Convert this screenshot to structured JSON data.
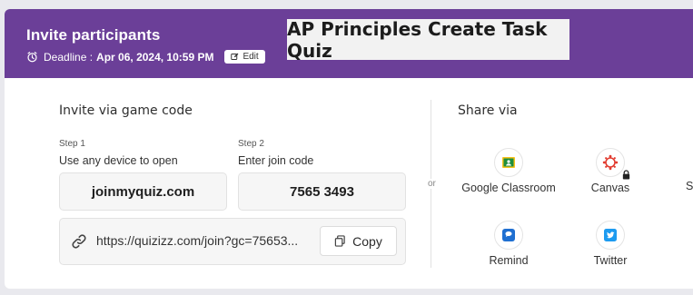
{
  "header": {
    "title": "Invite participants",
    "deadline_label": "Deadline :",
    "deadline_value": "Apr 06, 2024, 10:59 PM",
    "edit_label": "Edit",
    "quiz_title": "AP Principles Create Task Quiz",
    "bg_color": "#6b3f98",
    "clock_icon": "alarm-clock-icon",
    "edit_icon": "pencil-square-icon"
  },
  "invite": {
    "section_title": "Invite via game code",
    "step1_label": "Step 1",
    "step1_text": "Use any device to open",
    "site": "joinmyquiz.com",
    "step2_label": "Step 2",
    "step2_text": "Enter join code",
    "code": "7565 3493",
    "link_url": "https://quizizz.com/join?gc=75653...",
    "copy_label": "Copy",
    "link_icon": "link-icon",
    "copy_icon": "copy-icon"
  },
  "divider_text": "or",
  "share": {
    "title": "Share via",
    "items": [
      {
        "label": "Google Classroom",
        "icon": "google-classroom-icon"
      },
      {
        "label": "Canvas",
        "icon": "canvas-icon",
        "locked": true
      },
      {
        "label": "Remind",
        "icon": "remind-icon"
      },
      {
        "label": "Twitter",
        "icon": "twitter-icon"
      }
    ],
    "partial_label": "S"
  }
}
